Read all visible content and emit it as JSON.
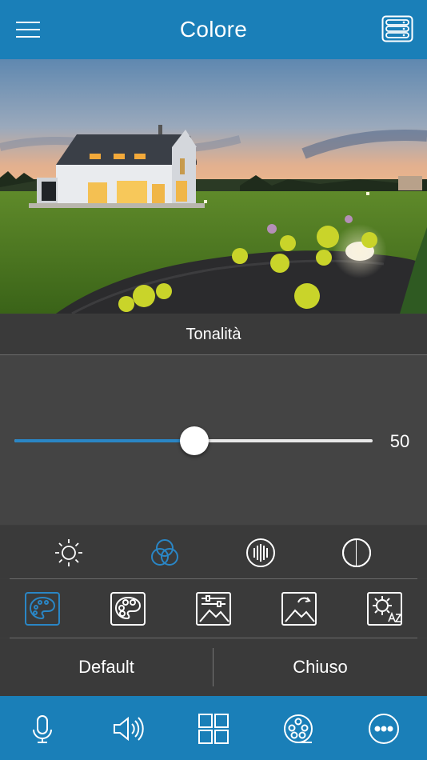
{
  "header": {
    "title": "Colore",
    "menu_icon": "hamburger-menu-icon",
    "device_icon": "device-list-icon"
  },
  "photo": {
    "description_icon": "house-at-dusk-image"
  },
  "adjustment": {
    "label": "Tonalità",
    "value": "50",
    "level_fraction": 0.5
  },
  "mode_icons": [
    "brightness-icon",
    "color-icon",
    "sharpness-icon",
    "contrast-icon"
  ],
  "preset_icons": [
    "palette-icon",
    "color-palette-icon",
    "picture-adjust-icon",
    "picture-mode-icon",
    "auto-settings-icon"
  ],
  "buttons": {
    "default_label": "Default",
    "close_label": "Chiuso"
  },
  "bottom_nav": [
    "microphone-icon",
    "volume-icon",
    "grid-icon",
    "media-icon",
    "more-icon"
  ],
  "colors": {
    "accent": "#1a7fb8",
    "active_icon": "#2a86c5",
    "panel": "#3a3a3a",
    "slider_panel": "#444444"
  }
}
